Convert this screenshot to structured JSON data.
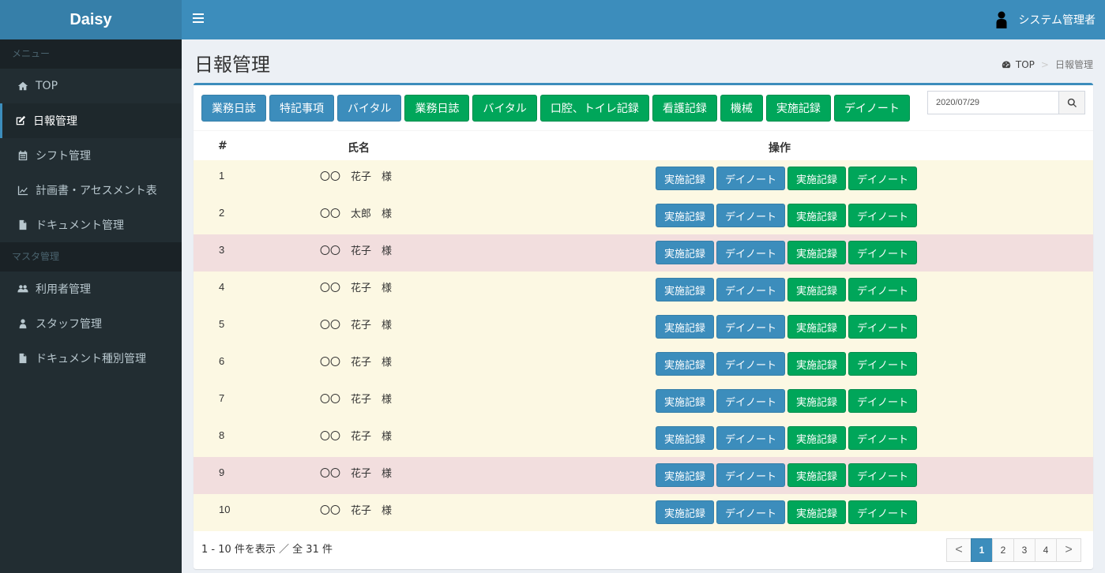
{
  "app": {
    "logo": "Daisy"
  },
  "header": {
    "user_name": "システム管理者"
  },
  "sidebar": {
    "section1": "メニュー",
    "items1": [
      {
        "label": "TOP",
        "icon": "home-icon"
      },
      {
        "label": "日報管理",
        "icon": "edit-icon",
        "active": true
      },
      {
        "label": "シフト管理",
        "icon": "calendar-icon"
      },
      {
        "label": "計画書・アセスメント表",
        "icon": "line-chart-icon"
      },
      {
        "label": "ドキュメント管理",
        "icon": "file-icon"
      }
    ],
    "section2": "マスタ管理",
    "items2": [
      {
        "label": "利用者管理",
        "icon": "users-icon"
      },
      {
        "label": "スタッフ管理",
        "icon": "user-icon"
      },
      {
        "label": "ドキュメント種別管理",
        "icon": "file-icon"
      }
    ]
  },
  "page": {
    "title": "日報管理",
    "breadcrumb_top": "TOP",
    "breadcrumb_current": "日報管理"
  },
  "toolbar": {
    "buttons": [
      {
        "label": "業務日誌",
        "color": "blue"
      },
      {
        "label": "特記事項",
        "color": "blue"
      },
      {
        "label": "バイタル",
        "color": "blue"
      },
      {
        "label": "業務日誌",
        "color": "green"
      },
      {
        "label": "バイタル",
        "color": "green"
      },
      {
        "label": "口腔、トイレ記録",
        "color": "green"
      },
      {
        "label": "看護記録",
        "color": "green"
      },
      {
        "label": "機械",
        "color": "green"
      },
      {
        "label": "実施記録",
        "color": "green"
      },
      {
        "label": "デイノート",
        "color": "green"
      }
    ],
    "date_value": "2020/07/29"
  },
  "table": {
    "headers": {
      "num": "#",
      "name": "氏名",
      "ops": "操作"
    },
    "op_labels": [
      "実施記録",
      "デイノート",
      "実施記録",
      "デイノート"
    ],
    "rows": [
      {
        "num": "1",
        "name": "〇〇　花子　様",
        "highlight": "yellow"
      },
      {
        "num": "2",
        "name": "〇〇　太郎　様",
        "highlight": "yellow"
      },
      {
        "num": "3",
        "name": "〇〇　花子　様",
        "highlight": "pink"
      },
      {
        "num": "4",
        "name": "〇〇　花子　様",
        "highlight": "yellow"
      },
      {
        "num": "5",
        "name": "〇〇　花子　様",
        "highlight": "yellow"
      },
      {
        "num": "6",
        "name": "〇〇　花子　様",
        "highlight": "yellow"
      },
      {
        "num": "7",
        "name": "〇〇　花子　様",
        "highlight": "yellow"
      },
      {
        "num": "8",
        "name": "〇〇　花子　様",
        "highlight": "yellow"
      },
      {
        "num": "9",
        "name": "〇〇　花子　様",
        "highlight": "pink"
      },
      {
        "num": "10",
        "name": "〇〇　花子　様",
        "highlight": "yellow"
      }
    ]
  },
  "footer": {
    "summary": "1 - 10 件を表示 ／ 全 31 件",
    "pages": [
      "1",
      "2",
      "3",
      "4"
    ],
    "current_page": "1",
    "prev": "<",
    "next": ">"
  },
  "colors": {
    "primary": "#3c8dbc",
    "success": "#00a65a",
    "sidebar_bg": "#222d32",
    "row_warning": "#fcf8e3",
    "row_danger": "#f2dede"
  }
}
